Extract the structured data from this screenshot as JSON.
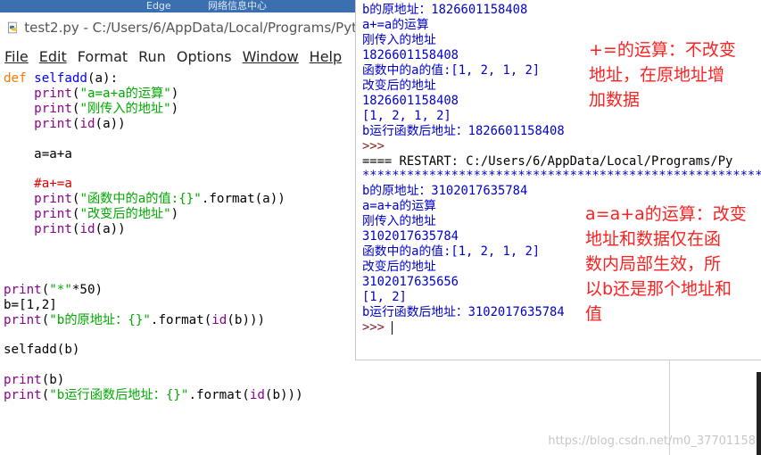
{
  "desktop": {
    "items": [
      "Edge",
      "网络信息中心"
    ]
  },
  "editor": {
    "title": "test2.py - C:/Users/6/AppData/Local/Programs/Pyt",
    "menu": [
      "File",
      "Edit",
      "Format",
      "Run",
      "Options",
      "Window",
      "Help"
    ]
  },
  "code_lines": [
    [
      {
        "t": "def ",
        "c": "kw"
      },
      {
        "t": "selfadd",
        "c": "df"
      },
      {
        "t": "(a):",
        "c": ""
      }
    ],
    [
      {
        "t": "    ",
        "c": ""
      },
      {
        "t": "print",
        "c": "bi"
      },
      {
        "t": "(",
        "c": ""
      },
      {
        "t": "\"a=a+a的运算\"",
        "c": "st"
      },
      {
        "t": ")",
        "c": ""
      }
    ],
    [
      {
        "t": "    ",
        "c": ""
      },
      {
        "t": "print",
        "c": "bi"
      },
      {
        "t": "(",
        "c": ""
      },
      {
        "t": "\"刚传入的地址\"",
        "c": "st"
      },
      {
        "t": ")",
        "c": ""
      }
    ],
    [
      {
        "t": "    ",
        "c": ""
      },
      {
        "t": "print",
        "c": "bi"
      },
      {
        "t": "(",
        "c": ""
      },
      {
        "t": "id",
        "c": "bi"
      },
      {
        "t": "(a))",
        "c": ""
      }
    ],
    [],
    [
      {
        "t": "    a=a+a",
        "c": ""
      }
    ],
    [],
    [
      {
        "t": "    #a+=a",
        "c": "cm"
      }
    ],
    [
      {
        "t": "    ",
        "c": ""
      },
      {
        "t": "print",
        "c": "bi"
      },
      {
        "t": "(",
        "c": ""
      },
      {
        "t": "\"函数中的a的值:{}\"",
        "c": "st"
      },
      {
        "t": ".format(a))",
        "c": ""
      }
    ],
    [
      {
        "t": "    ",
        "c": ""
      },
      {
        "t": "print",
        "c": "bi"
      },
      {
        "t": "(",
        "c": ""
      },
      {
        "t": "\"改变后的地址\"",
        "c": "st"
      },
      {
        "t": ")",
        "c": ""
      }
    ],
    [
      {
        "t": "    ",
        "c": ""
      },
      {
        "t": "print",
        "c": "bi"
      },
      {
        "t": "(",
        "c": ""
      },
      {
        "t": "id",
        "c": "bi"
      },
      {
        "t": "(a))",
        "c": ""
      }
    ],
    [],
    [],
    [],
    [
      {
        "t": "print",
        "c": "bi"
      },
      {
        "t": "(",
        "c": ""
      },
      {
        "t": "\"*\"",
        "c": "st"
      },
      {
        "t": "*50)",
        "c": ""
      }
    ],
    [
      {
        "t": "b=[1,2]",
        "c": ""
      }
    ],
    [
      {
        "t": "print",
        "c": "bi"
      },
      {
        "t": "(",
        "c": ""
      },
      {
        "t": "\"b的原地址：{}\"",
        "c": "st"
      },
      {
        "t": ".format(",
        "c": ""
      },
      {
        "t": "id",
        "c": "bi"
      },
      {
        "t": "(b)))",
        "c": ""
      }
    ],
    [],
    [
      {
        "t": "selfadd(b)",
        "c": ""
      }
    ],
    [],
    [
      {
        "t": "print",
        "c": "bi"
      },
      {
        "t": "(b)",
        "c": ""
      }
    ],
    [
      {
        "t": "print",
        "c": "bi"
      },
      {
        "t": "(",
        "c": ""
      },
      {
        "t": "\"b运行函数后地址：{}\"",
        "c": "st"
      },
      {
        "t": ".format(",
        "c": ""
      },
      {
        "t": "id",
        "c": "bi"
      },
      {
        "t": "(b)))",
        "c": ""
      }
    ]
  ],
  "shell_lines": [
    {
      "t": "b的原地址：1826601158408",
      "c": ""
    },
    {
      "t": "a+=a的运算",
      "c": ""
    },
    {
      "t": "刚传入的地址",
      "c": ""
    },
    {
      "t": "1826601158408",
      "c": ""
    },
    {
      "t": "函数中的a的值:[1, 2, 1, 2]",
      "c": ""
    },
    {
      "t": "改变后的地址",
      "c": ""
    },
    {
      "t": "1826601158408",
      "c": ""
    },
    {
      "t": "[1, 2, 1, 2]",
      "c": ""
    },
    {
      "t": "b运行函数后地址：1826601158408",
      "c": ""
    },
    {
      "t": ">>> ",
      "c": "p"
    },
    {
      "t": "==== RESTART: C:/Users/6/AppData/Local/Programs/Py",
      "c": "k"
    },
    {
      "t": "******************************************************",
      "c": "stars"
    },
    {
      "t": "b的原地址：3102017635784",
      "c": ""
    },
    {
      "t": "a=a+a的运算",
      "c": ""
    },
    {
      "t": "刚传入的地址",
      "c": ""
    },
    {
      "t": "3102017635784",
      "c": ""
    },
    {
      "t": "函数中的a的值:[1, 2, 1, 2]",
      "c": ""
    },
    {
      "t": "改变后的地址",
      "c": ""
    },
    {
      "t": "3102017635656",
      "c": ""
    },
    {
      "t": "[1, 2]",
      "c": ""
    },
    {
      "t": "b运行函数后地址：3102017635784",
      "c": ""
    },
    {
      "t": ">>> ",
      "c": "p",
      "caret": true
    }
  ],
  "notes": {
    "note1": [
      "+=的运算：不改变",
      "地址，在原地址增",
      "加数据"
    ],
    "note2": [
      "a=a+a的运算：改变",
      "地址和数据仅在函",
      "数内局部生效，所",
      "以b还是那个地址和",
      "值"
    ]
  },
  "watermark": "https://blog.csdn.net/m0_37701158"
}
